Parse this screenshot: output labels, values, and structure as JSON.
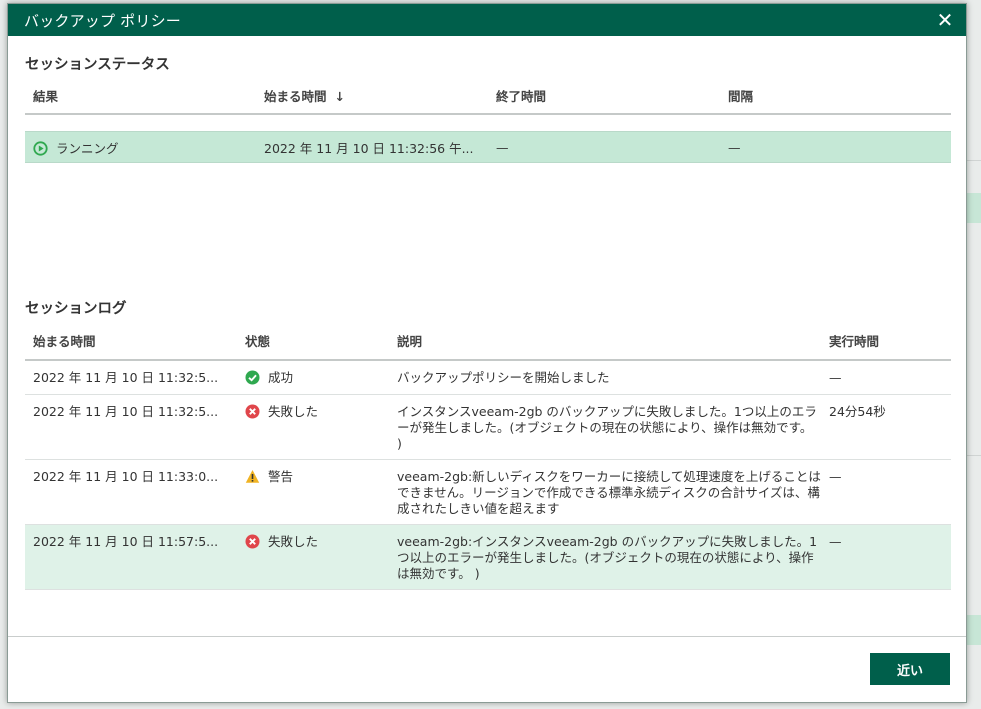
{
  "dialog": {
    "title": "バックアップ ポリシー",
    "close_glyph": "✕"
  },
  "session_status": {
    "title": "セッションステータス",
    "columns": [
      "結果",
      "始まる時間",
      "終了時間",
      "間隔"
    ],
    "sort_arrow": "↓",
    "row": {
      "result": "ランニング",
      "start": "2022 年 11 月 10 日 11:32:56 午...",
      "end": "—",
      "interval": "—"
    }
  },
  "session_log": {
    "title": "セッションログ",
    "columns": [
      "始まる時間",
      "状態",
      "説明",
      "実行時間"
    ],
    "rows": [
      {
        "start": "2022 年 11 月 10 日 11:32:5...",
        "status": "成功",
        "status_icon": "success-icon",
        "description": "バックアップポリシーを開始しました",
        "duration": "—"
      },
      {
        "start": "2022 年 11 月 10 日 11:32:5...",
        "status": "失敗した",
        "status_icon": "error-icon",
        "description": "インスタンスveeam-2gb のバックアップに失敗しました。1つ以上のエラーが発生しました。(オブジェクトの現在の状態により、操作は無効です。 )",
        "duration": "24分54秒"
      },
      {
        "start": "2022 年 11 月 10 日 11:33:0...",
        "status": "警告",
        "status_icon": "warning-icon",
        "description": "veeam-2gb:新しいディスクをワーカーに接続して処理速度を上げることはできません。リージョンで作成できる標準永続ディスクの合計サイズは、構成されたしきい値を超えます",
        "duration": "—"
      },
      {
        "start": "2022 年 11 月 10 日 11:57:5...",
        "status": "失敗した",
        "status_icon": "error-icon",
        "description": "veeam-2gb:インスタンスveeam-2gb のバックアップに失敗しました。1つ以上のエラーが発生しました。(オブジェクトの現在の状態により、操作は無効です。 )",
        "duration": "—"
      }
    ]
  },
  "footer": {
    "close_label": "近い"
  },
  "colors": {
    "accent": "#005f4b",
    "selected_row": "#c5e8d6",
    "success": "#2fa84f",
    "error": "#e0464b",
    "warning": "#f0b323"
  }
}
